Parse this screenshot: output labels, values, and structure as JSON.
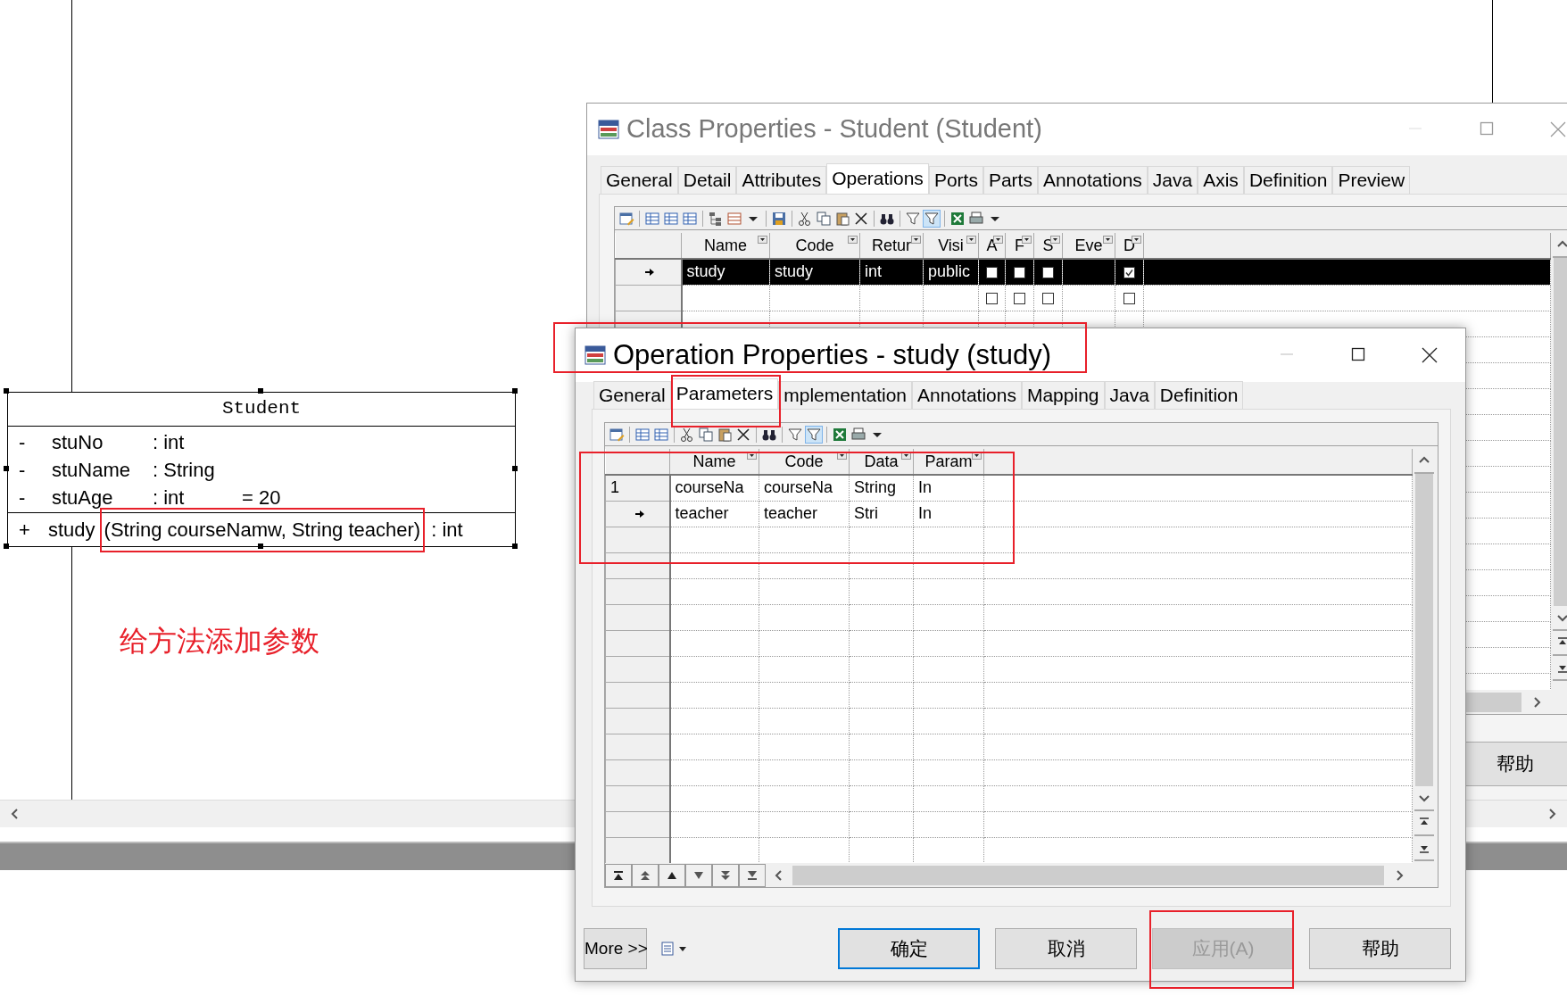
{
  "diagram": {
    "class_box": {
      "name": "Student",
      "attributes": [
        {
          "visibility": "-",
          "name": "stuNo",
          "type": ": int"
        },
        {
          "visibility": "-",
          "name": "stuName",
          "type": ": String"
        },
        {
          "visibility": "-",
          "name": "stuAge",
          "type": ": int",
          "initial": "= 20"
        }
      ],
      "operations": [
        {
          "visibility": "+",
          "name": "study",
          "params": "(String courseNamw, String teacher)",
          "returns": ": int",
          "highlighted": true
        }
      ]
    },
    "note": "给方法添加参数"
  },
  "class_window": {
    "title": "Class Properties - Student (Student)",
    "active": false,
    "tabs": [
      {
        "label": "General",
        "selected": false
      },
      {
        "label": "Detail",
        "selected": false
      },
      {
        "label": "Attributes",
        "selected": false
      },
      {
        "label": "Operations",
        "selected": true
      },
      {
        "label": "Ports",
        "selected": false
      },
      {
        "label": "Parts",
        "selected": false
      },
      {
        "label": "Annotations",
        "selected": false
      },
      {
        "label": "Java",
        "selected": false
      },
      {
        "label": "Axis",
        "selected": false
      },
      {
        "label": "Definition",
        "selected": false
      },
      {
        "label": "Preview",
        "selected": false
      }
    ],
    "grid": {
      "columns": [
        "Name",
        "Code",
        "Retur",
        "Visi",
        "A",
        "F",
        "S",
        "Eve",
        "D"
      ],
      "rows": [
        {
          "current": true,
          "selected": true,
          "cells": [
            {
              "kind": "text",
              "text": "study"
            },
            {
              "kind": "text",
              "text": "study"
            },
            {
              "kind": "text",
              "text": "int"
            },
            {
              "kind": "text",
              "text": "public"
            },
            {
              "kind": "check",
              "checked": false
            },
            {
              "kind": "check",
              "checked": false
            },
            {
              "kind": "check",
              "checked": false
            },
            {
              "kind": "empty"
            },
            {
              "kind": "check",
              "checked": true
            }
          ]
        },
        {
          "current": false,
          "selected": false,
          "cells": [
            {
              "kind": "empty"
            },
            {
              "kind": "empty"
            },
            {
              "kind": "empty"
            },
            {
              "kind": "empty"
            },
            {
              "kind": "check",
              "checked": false
            },
            {
              "kind": "check",
              "checked": false
            },
            {
              "kind": "check",
              "checked": false
            },
            {
              "kind": "empty"
            },
            {
              "kind": "check",
              "checked": false
            }
          ]
        }
      ]
    },
    "buttons": [
      {
        "label": "帮助"
      }
    ]
  },
  "operation_dialog": {
    "title": "Operation Properties - study (study)",
    "active": true,
    "title_highlighted": true,
    "tabs": [
      {
        "label": "General",
        "selected": false,
        "highlighted": false
      },
      {
        "label": "Parameters",
        "selected": true,
        "highlighted": true
      },
      {
        "label": "mplementation",
        "selected": false,
        "highlighted": false
      },
      {
        "label": "Annotations",
        "selected": false,
        "highlighted": false
      },
      {
        "label": "Mapping",
        "selected": false,
        "highlighted": false
      },
      {
        "label": "Java",
        "selected": false,
        "highlighted": false
      },
      {
        "label": "Definition",
        "selected": false,
        "highlighted": false
      }
    ],
    "grid": {
      "highlighted": true,
      "columns": [
        "Name",
        "Code",
        "Data",
        "Param"
      ],
      "rows": [
        {
          "label": "1",
          "current": false,
          "cells": [
            "courseNa",
            "courseNa",
            "String",
            "In"
          ]
        },
        {
          "current": true,
          "cells": [
            "teacher",
            "teacher",
            "Stri",
            "In"
          ]
        }
      ]
    },
    "more_button": "More >>",
    "buttons": [
      {
        "label": "确定",
        "default": true,
        "disabled": false,
        "highlighted": false
      },
      {
        "label": "取消",
        "default": false,
        "disabled": false,
        "highlighted": false
      },
      {
        "label": "应用(A)",
        "default": false,
        "disabled": true,
        "highlighted": true
      },
      {
        "label": "帮助",
        "default": false,
        "disabled": false,
        "highlighted": false
      }
    ]
  }
}
